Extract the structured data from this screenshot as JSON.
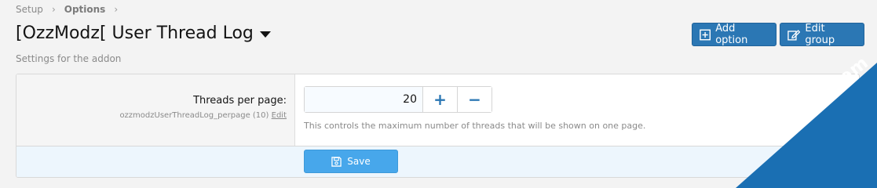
{
  "breadcrumb": {
    "items": [
      "Setup",
      "Options"
    ],
    "separator": "›"
  },
  "header": {
    "title": "[OzzModz[ User Thread Log",
    "description": "Settings for the addon",
    "add_option_label": "Add option",
    "edit_group_label": "Edit group"
  },
  "option": {
    "label": "Threads per page:",
    "hint_id": "ozzmodzUserThreadLog_perpage (10)",
    "hint_edit": "Edit",
    "value": "20",
    "explain": "This controls the maximum number of threads that will be shown on one page.",
    "plus": "+",
    "minus": "−"
  },
  "footer": {
    "save_label": "Save"
  },
  "watermark": {
    "text": "XenBD.Com"
  },
  "colors": {
    "primary": "#2b77b4",
    "save": "#47a7eb",
    "footer_bg": "#edf6fd",
    "watermark": "#1a6fb3"
  }
}
